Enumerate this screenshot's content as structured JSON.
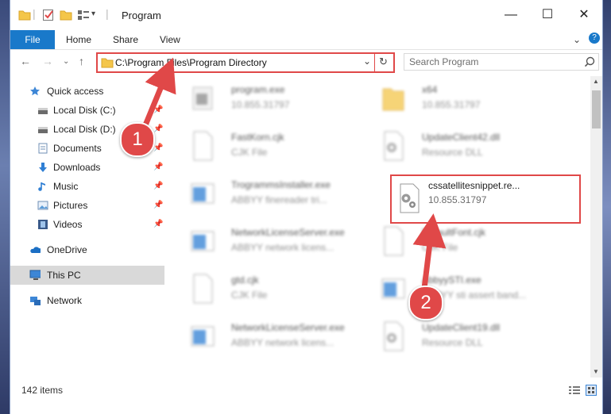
{
  "window": {
    "title": "Program",
    "controls": {
      "minimize": "—",
      "maximize": "☐",
      "close": "✕"
    }
  },
  "ribbon": {
    "tabs": [
      "File",
      "Home",
      "Share",
      "View"
    ],
    "chevron": "⌄",
    "help": "?"
  },
  "address": {
    "path": "C:\\Program Files\\Program Directory",
    "dropdown": "⌄",
    "refresh": "↻",
    "nav_back": "←",
    "nav_forward": "→",
    "nav_recent": "⌄",
    "nav_up": "↑"
  },
  "search": {
    "placeholder": "Search Program"
  },
  "sidebar": {
    "items": [
      {
        "label": "Quick access",
        "icon": "star-icon",
        "pinned": false
      },
      {
        "label": "Local Disk (C:)",
        "icon": "drive-icon",
        "pinned": true
      },
      {
        "label": "Local Disk (D:)",
        "icon": "drive-icon",
        "pinned": true
      },
      {
        "label": "Documents",
        "icon": "documents-icon",
        "pinned": true
      },
      {
        "label": "Downloads",
        "icon": "download-arrow-icon",
        "pinned": true
      },
      {
        "label": "Music",
        "icon": "music-note-icon",
        "pinned": true
      },
      {
        "label": "Pictures",
        "icon": "pictures-icon",
        "pinned": true
      },
      {
        "label": "Videos",
        "icon": "film-icon",
        "pinned": true
      },
      {
        "label": "OneDrive",
        "icon": "cloud-icon",
        "pinned": false
      },
      {
        "label": "This PC",
        "icon": "monitor-icon",
        "pinned": false
      },
      {
        "label": "Network",
        "icon": "network-icon",
        "pinned": false
      }
    ],
    "pin_glyph": "📌"
  },
  "files": [
    {
      "name": "program.exe",
      "sub": "10.855.31797",
      "icon": "exe-icon"
    },
    {
      "name": "x64",
      "sub": "10.855.31797",
      "icon": "folder-icon"
    },
    {
      "name": "FastKorn.cjk",
      "sub": "CJK File",
      "icon": "blank-file-icon"
    },
    {
      "name": "UpdateClient42.dll",
      "sub": "Resource DLL",
      "icon": "gear-file-icon"
    },
    {
      "name": "TrogrammsInstaller.exe",
      "sub": "ABBYY finereader tri...",
      "icon": "app-window-icon"
    },
    {
      "name": "cssatellitesnippet.re...",
      "sub": "10.855.31797",
      "icon": "gear-file-icon"
    },
    {
      "name": "NetworkLicenseServer.exe",
      "sub": "ABBYY network licens...",
      "icon": "app-window-icon"
    },
    {
      "name": "DefaultFont.cjk",
      "sub": "CJK File",
      "icon": "blank-file-icon"
    },
    {
      "name": "gtd.cjk",
      "sub": "CJK File",
      "icon": "blank-file-icon"
    },
    {
      "name": "AbbyySTI.exe",
      "sub": "ABBYY sti assert band...",
      "icon": "app-window-icon"
    },
    {
      "name": "NetworkLicenseServer.exe",
      "sub": "ABBYY network licens...",
      "icon": "app-window-icon"
    },
    {
      "name": "UpdateClient19.dll",
      "sub": "Resource DLL",
      "icon": "gear-file-icon"
    }
  ],
  "status": {
    "item_count": "142 items"
  },
  "annotations": {
    "marker1": "1",
    "marker2": "2"
  },
  "colors": {
    "accent": "#1979ca",
    "highlight": "#e04848",
    "selection": "#d9d9d9"
  }
}
